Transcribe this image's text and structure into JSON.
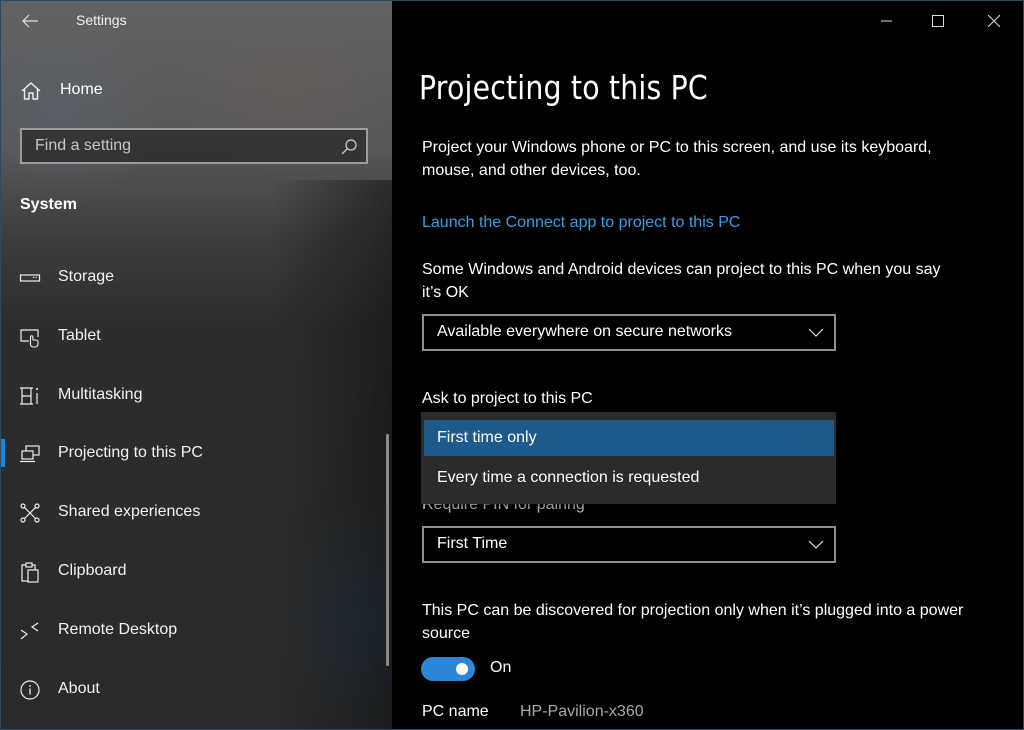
{
  "window": {
    "app_title": "Settings",
    "controls": {
      "minimize": "minimize-icon",
      "maximize": "maximize-icon",
      "close": "close-icon"
    }
  },
  "sidebar": {
    "back_icon": "back-arrow-icon",
    "home": {
      "label": "Home",
      "icon": "home-icon"
    },
    "search": {
      "placeholder": "Find a setting",
      "value": "",
      "icon": "search-icon"
    },
    "section_title": "System",
    "items": [
      {
        "label": "Storage",
        "icon": "storage-icon",
        "active": false
      },
      {
        "label": "Tablet",
        "icon": "tablet-icon",
        "active": false
      },
      {
        "label": "Multitasking",
        "icon": "multitasking-icon",
        "active": false
      },
      {
        "label": "Projecting to this PC",
        "icon": "projecting-icon",
        "active": true
      },
      {
        "label": "Shared experiences",
        "icon": "shared-experiences-icon",
        "active": false
      },
      {
        "label": "Clipboard",
        "icon": "clipboard-icon",
        "active": false
      },
      {
        "label": "Remote Desktop",
        "icon": "remote-desktop-icon",
        "active": false
      },
      {
        "label": "About",
        "icon": "info-icon",
        "active": false
      }
    ]
  },
  "main": {
    "title": "Projecting to this PC",
    "description": "Project your Windows phone or PC to this screen, and use its keyboard, mouse, and other devices, too.",
    "connect_link": "Launch the Connect app to project to this PC",
    "availability": {
      "label": "Some Windows and Android devices can project to this PC when you say it’s OK",
      "selected": "Available everywhere on secure networks"
    },
    "ask_to_project": {
      "label": "Ask to project to this PC",
      "options": [
        {
          "label": "First time only",
          "highlighted": true
        },
        {
          "label": "Every time a connection is requested",
          "highlighted": false
        }
      ]
    },
    "require_pin": {
      "label": "Require PIN for pairing",
      "selected": "First Time"
    },
    "power_source": {
      "label": "This PC can be discovered for projection only when it’s plugged into a power source",
      "toggle_state": true,
      "toggle_label": "On"
    },
    "pc_name": {
      "label": "PC name",
      "value": "HP-Pavilion-x360"
    }
  },
  "colors": {
    "accent": "#2d87d6",
    "link": "#3a9ee4",
    "selection": "#1d5c8f"
  }
}
